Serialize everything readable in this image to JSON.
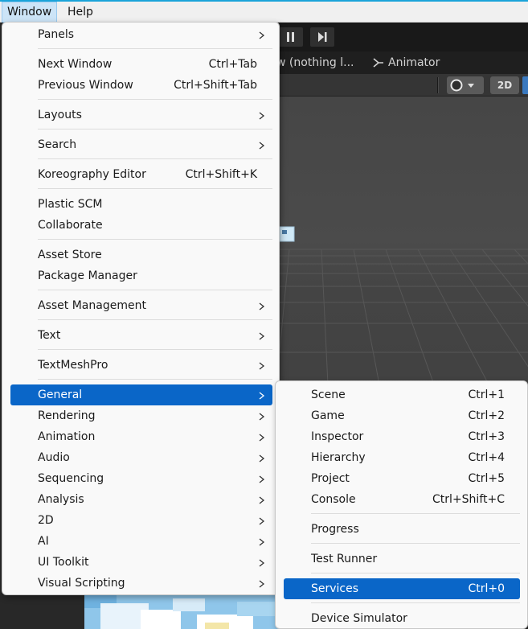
{
  "menubar": {
    "items": [
      {
        "label": "Window"
      },
      {
        "label": "Help"
      }
    ]
  },
  "background": {
    "tabs": [
      {
        "label": "w (nothing l..."
      },
      {
        "label": "Animator",
        "icon": "animator-icon"
      }
    ],
    "scene_toolbar": {
      "mode_2d": "2D"
    }
  },
  "window_menu": {
    "items": [
      {
        "label": "Panels",
        "submenu": true
      },
      {
        "label": "Next Window",
        "shortcut": "Ctrl+Tab"
      },
      {
        "label": "Previous Window",
        "shortcut": "Ctrl+Shift+Tab"
      },
      {
        "label": "Layouts",
        "submenu": true
      },
      {
        "label": "Search",
        "submenu": true
      },
      {
        "label": "Koreography Editor",
        "shortcut": "Ctrl+Shift+K"
      },
      {
        "label": "Plastic SCM"
      },
      {
        "label": "Collaborate"
      },
      {
        "label": "Asset Store"
      },
      {
        "label": "Package Manager"
      },
      {
        "label": "Asset Management",
        "submenu": true
      },
      {
        "label": "Text",
        "submenu": true
      },
      {
        "label": "TextMeshPro",
        "submenu": true
      },
      {
        "label": "General",
        "submenu": true,
        "highlighted": true
      },
      {
        "label": "Rendering",
        "submenu": true
      },
      {
        "label": "Animation",
        "submenu": true
      },
      {
        "label": "Audio",
        "submenu": true
      },
      {
        "label": "Sequencing",
        "submenu": true
      },
      {
        "label": "Analysis",
        "submenu": true
      },
      {
        "label": "2D",
        "submenu": true
      },
      {
        "label": "AI",
        "submenu": true
      },
      {
        "label": "UI Toolkit",
        "submenu": true
      },
      {
        "label": "Visual Scripting",
        "submenu": true
      }
    ]
  },
  "general_submenu": {
    "items": [
      {
        "label": "Scene",
        "shortcut": "Ctrl+1"
      },
      {
        "label": "Game",
        "shortcut": "Ctrl+2"
      },
      {
        "label": "Inspector",
        "shortcut": "Ctrl+3"
      },
      {
        "label": "Hierarchy",
        "shortcut": "Ctrl+4"
      },
      {
        "label": "Project",
        "shortcut": "Ctrl+5"
      },
      {
        "label": "Console",
        "shortcut": "Ctrl+Shift+C"
      },
      {
        "label": "Progress"
      },
      {
        "label": "Test Runner"
      },
      {
        "label": "Services",
        "shortcut": "Ctrl+0",
        "highlighted": true
      },
      {
        "label": "Device Simulator"
      }
    ]
  },
  "colors": {
    "highlight": "#0a66c8",
    "menu_bg": "#f9f9f9",
    "accent_line": "#1aa3d9"
  }
}
